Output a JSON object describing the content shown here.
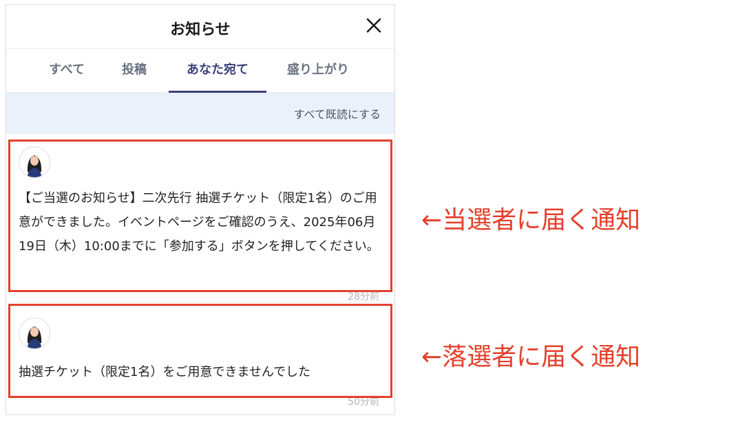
{
  "header": {
    "title": "お知らせ",
    "close_icon": "close-icon"
  },
  "tabs": [
    {
      "label": "すべて",
      "active": false
    },
    {
      "label": "投稿",
      "active": false
    },
    {
      "label": "あなた宛て",
      "active": true
    },
    {
      "label": "盛り上がり",
      "active": false
    }
  ],
  "toolbar": {
    "mark_all_read": "すべて既読にする"
  },
  "notifications": [
    {
      "avatar_icon": "user-avatar",
      "text": "【ご当選のお知らせ】二次先行 抽選チケット（限定1名）のご用意ができました。イベントページをご確認のうえ、2025年06月19日（木）10:00までに「参加する」ボタンを押してください。",
      "time": "28分前"
    },
    {
      "avatar_icon": "user-avatar",
      "text": "抽選チケット（限定1名）をご用意できませんでした",
      "time": "50分前"
    }
  ],
  "annotations": [
    "←当選者に届く通知",
    "←落選者に届く通知"
  ],
  "colors": {
    "accent_tab": "#3b3f7a",
    "highlight": "#e4402c",
    "markread_bar_bg": "#eaf1fa"
  }
}
